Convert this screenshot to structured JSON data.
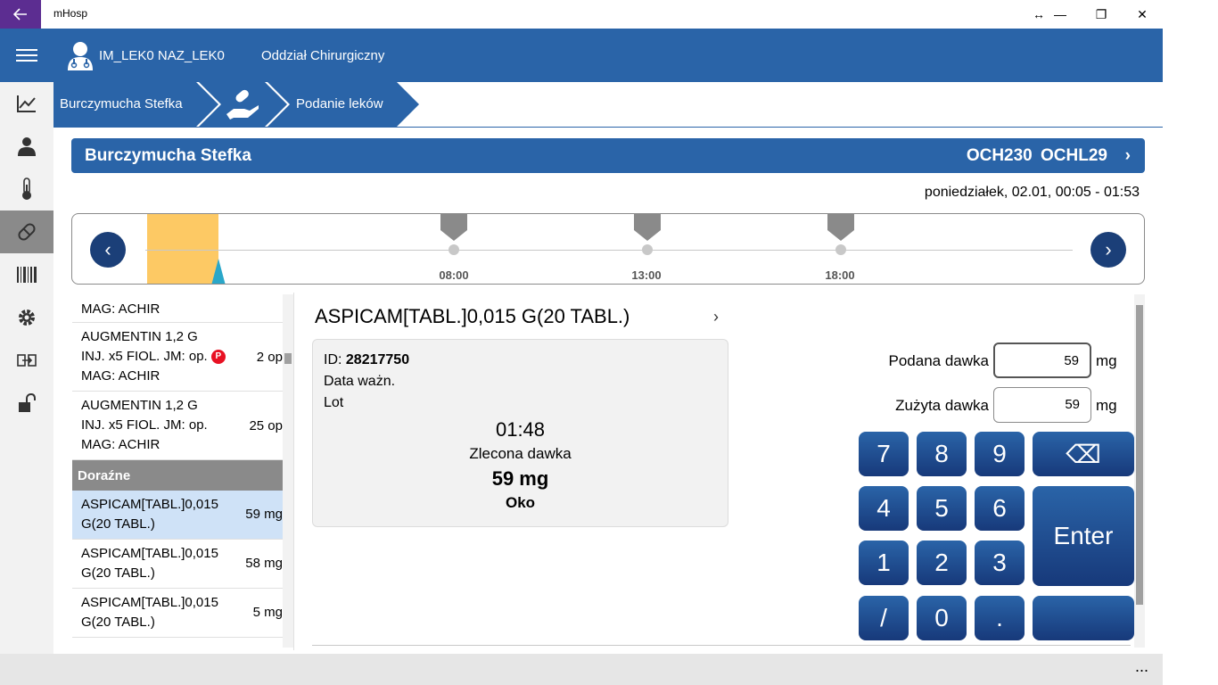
{
  "window": {
    "title": "mHosp",
    "back_icon": "arrow-left-icon",
    "resize_glyph": "↔",
    "minimize_glyph": "—",
    "restore_glyph": "❐",
    "close_glyph": "✕"
  },
  "header": {
    "user": "IM_LEK0 NAZ_LEK0",
    "ward": "Oddział Chirurgiczny",
    "bg_color": "#2a64a8"
  },
  "sidebar": {
    "items": [
      {
        "icon": "chart-line-icon"
      },
      {
        "icon": "person-icon"
      },
      {
        "icon": "thermometer-icon"
      },
      {
        "icon": "pill-icon",
        "active": true
      },
      {
        "icon": "barcode-icon"
      },
      {
        "icon": "gear-icon"
      },
      {
        "icon": "swap-icon"
      },
      {
        "icon": "unlock-icon"
      }
    ]
  },
  "breadcrumb": {
    "patient": "Burczymucha Stefka",
    "section": "Podanie leków"
  },
  "patient": {
    "name": "Burczymucha Stefka",
    "codes": "OCH230 OCHL29",
    "chevron": "›"
  },
  "date_range": "poniedziałek, 02.01, 00:05 - 01:53",
  "timeline": {
    "labels": [
      "08:00",
      "13:00",
      "18:00"
    ],
    "current_color": "#fdc964",
    "marker_color": "#8a8a8a",
    "prev_glyph": "‹",
    "next_glyph": "›"
  },
  "med_list": {
    "partial_top": {
      "line": "MAG: ACHIR"
    },
    "items_top": [
      {
        "line1": "AUGMENTIN 1,2 G",
        "line2": "INJ.  x5 FIOL. JM: op.",
        "line3": "MAG: ACHIR",
        "qty": "2 op",
        "badge": "P"
      },
      {
        "line1": "AUGMENTIN 1,2 G",
        "line2": "INJ.  x5 FIOL. JM: op.",
        "line3": "MAG: ACHIR",
        "qty": "25 op"
      }
    ],
    "section": "Doraźne",
    "items_bottom": [
      {
        "line1": "ASPICAM[TABL.]0,015",
        "line2": "G(20 TABL.)",
        "qty": "59 mg",
        "selected": true
      },
      {
        "line1": "ASPICAM[TABL.]0,015",
        "line2": "G(20 TABL.)",
        "qty": "58 mg"
      },
      {
        "line1": "ASPICAM[TABL.]0,015",
        "line2": "G(20 TABL.)",
        "qty": "5 mg"
      }
    ]
  },
  "drug": {
    "title": "ASPICAM[TABL.]0,015 G(20 TABL.)",
    "chevron": "›",
    "id_label": "ID:",
    "id_value": "28217750",
    "expiry_label": "Data ważn.",
    "lot_label": "Lot",
    "time": "01:48",
    "ordered_label": "Zlecona dawka",
    "ordered_value": "59 mg",
    "route": "Oko"
  },
  "dose": {
    "given_label": "Podana dawka",
    "given_value": "59",
    "used_label": "Zużyta dawka",
    "used_value": "59",
    "unit": "mg"
  },
  "keypad": {
    "keys": [
      "7",
      "8",
      "9",
      "4",
      "5",
      "6",
      "1",
      "2",
      "3",
      "/",
      "0",
      "."
    ],
    "backspace_glyph": "⌫",
    "enter": "Enter"
  },
  "appbar": {
    "more": "..."
  }
}
